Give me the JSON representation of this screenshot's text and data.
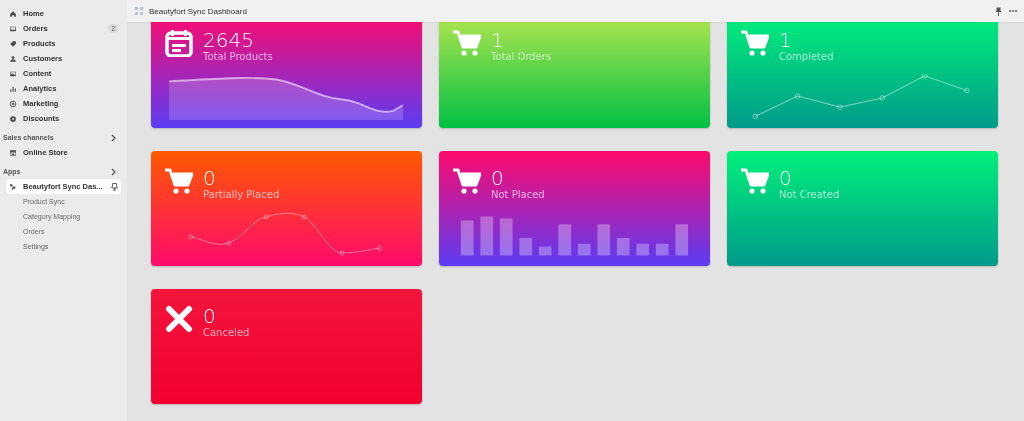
{
  "sidebar": {
    "items": [
      {
        "label": "Home"
      },
      {
        "label": "Orders",
        "badge": "2"
      },
      {
        "label": "Products"
      },
      {
        "label": "Customers"
      },
      {
        "label": "Content"
      },
      {
        "label": "Analytics"
      },
      {
        "label": "Marketing"
      },
      {
        "label": "Discounts"
      }
    ],
    "sections": [
      {
        "title": "Sales channels",
        "items": [
          {
            "label": "Online Store",
            "selected": false
          }
        ]
      },
      {
        "title": "Apps",
        "items": [
          {
            "label": "Beautyfort Sync Das...",
            "selected": true,
            "children": [
              {
                "label": "Product Sync"
              },
              {
                "label": "Category Mapping"
              },
              {
                "label": "Orders"
              },
              {
                "label": "Settings"
              }
            ]
          }
        ]
      }
    ]
  },
  "top_bar": {
    "title": "Beautyfort Sync Dashboard"
  },
  "cards": [
    {
      "value": "2645",
      "label": "Total Products",
      "kind": "area"
    },
    {
      "value": "1",
      "label": "Total Orders",
      "kind": "plain"
    },
    {
      "value": "1",
      "label": "Completed",
      "kind": "line"
    },
    {
      "value": "0",
      "label": "Partially Placed",
      "kind": "curve"
    },
    {
      "value": "0",
      "label": "Not Placed",
      "kind": "bars"
    },
    {
      "value": "0",
      "label": "Not Created",
      "kind": "plain"
    },
    {
      "value": "0",
      "label": "Canceled",
      "kind": "plain"
    }
  ]
}
